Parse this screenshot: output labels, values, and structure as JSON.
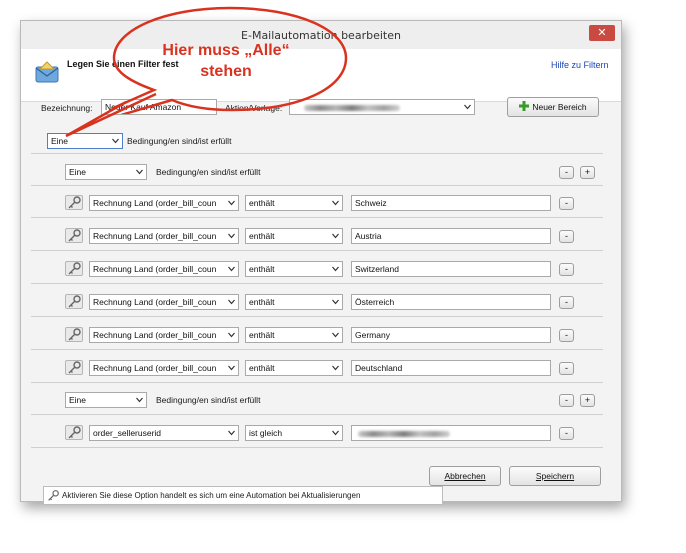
{
  "window": {
    "title": "E-Mailautomation bearbeiten",
    "close_label": "✕"
  },
  "header": {
    "heading": "Legen Sie einen Filter fest",
    "help_link": "Hilfe zu Filtern"
  },
  "form": {
    "bezeichnung_label": "Bezeichnung:",
    "bezeichnung_value": "Neuer Kauf Amazon",
    "aktion_label": "Aktion/Vorlage:",
    "new_area_button": "Neuer Bereich"
  },
  "top_condition": {
    "select": "Eine",
    "text": "Bedingung/en sind/ist erfüllt"
  },
  "group1": {
    "select": "Eine",
    "text": "Bedingung/en sind/ist erfüllt",
    "rows": [
      {
        "field": "Rechnung Land (order_bill_coun",
        "op": "enthält",
        "value": "Schweiz"
      },
      {
        "field": "Rechnung Land (order_bill_coun",
        "op": "enthält",
        "value": "Austria"
      },
      {
        "field": "Rechnung Land (order_bill_coun",
        "op": "enthält",
        "value": "Switzerland"
      },
      {
        "field": "Rechnung Land (order_bill_coun",
        "op": "enthält",
        "value": "Österreich"
      },
      {
        "field": "Rechnung Land (order_bill_coun",
        "op": "enthält",
        "value": "Germany"
      },
      {
        "field": "Rechnung Land (order_bill_coun",
        "op": "enthält",
        "value": "Deutschland"
      }
    ]
  },
  "group2": {
    "select": "Eine",
    "text": "Bedingung/en sind/ist erfüllt",
    "rows": [
      {
        "field": "order_selleruserid",
        "op": "ist gleich",
        "value": ""
      }
    ]
  },
  "buttons": {
    "minus": "-",
    "plus": "+"
  },
  "footer": {
    "option_text": "Aktivieren Sie diese Option handelt es sich um eine Automation bei Aktualisierungen",
    "cancel": "Abbrechen",
    "save": "Speichern"
  },
  "annotation": {
    "line1": "Hier muss „Alle“",
    "line2": "stehen"
  },
  "colors": {
    "accent_red": "#d9321f",
    "link_blue": "#1a48b8",
    "close_red": "#c84a40"
  },
  "icons": [
    "envelope-icon",
    "key-icon",
    "plus-green-icon",
    "chevron-down-icon"
  ]
}
